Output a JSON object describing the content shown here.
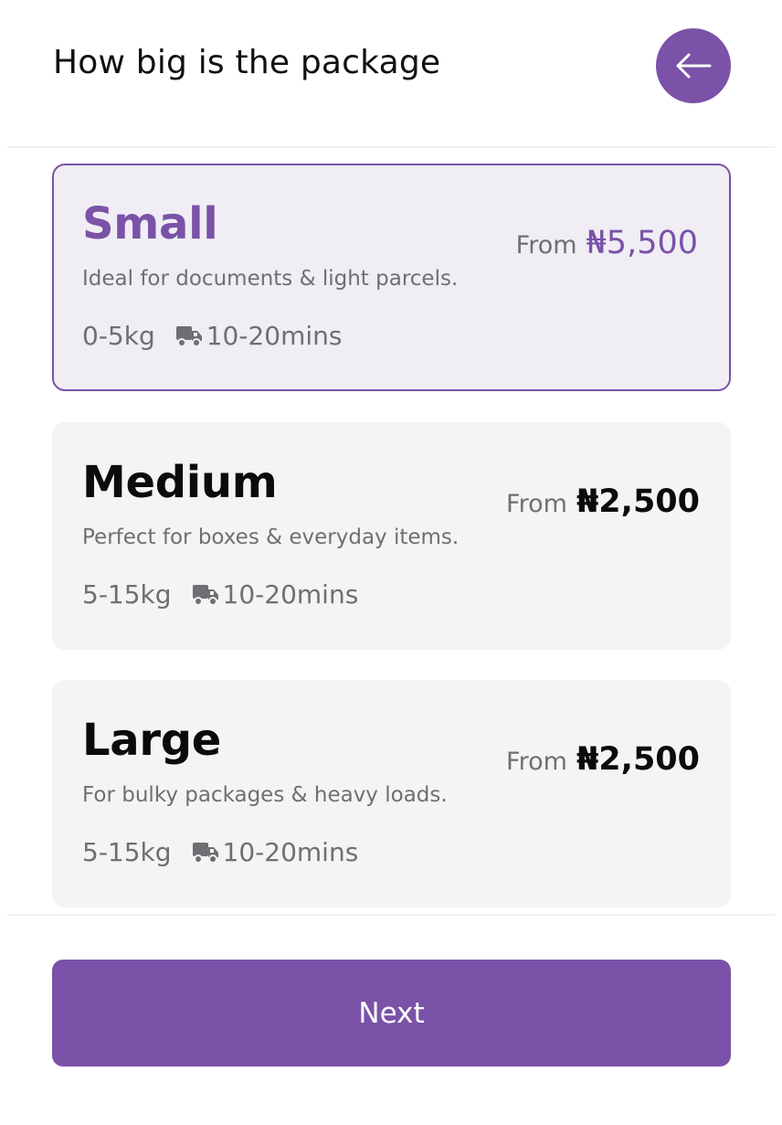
{
  "header": {
    "title": "How big is the package",
    "back_icon": "arrow-left-icon"
  },
  "colors": {
    "accent": "#7a52a7",
    "selected_card_bg": "#f0edf5",
    "card_bg": "#f4f4f5",
    "muted_text": "#6f6f73"
  },
  "packages": [
    {
      "name": "Small",
      "description": "Ideal for documents & light parcels.",
      "weight": "0-5kg",
      "delivery_time": "10-20mins",
      "price_prefix": "From",
      "price": "₦5,500",
      "selected": true
    },
    {
      "name": "Medium",
      "description": "Perfect for boxes & everyday items.",
      "weight": "5-15kg",
      "delivery_time": "10-20mins",
      "price_prefix": "From",
      "price": "₦2,500",
      "selected": false
    },
    {
      "name": "Large",
      "description": "For bulky packages & heavy loads.",
      "weight": "5-15kg",
      "delivery_time": "10-20mins",
      "price_prefix": "From",
      "price": "₦2,500",
      "selected": false
    }
  ],
  "footer": {
    "next_label": "Next"
  }
}
